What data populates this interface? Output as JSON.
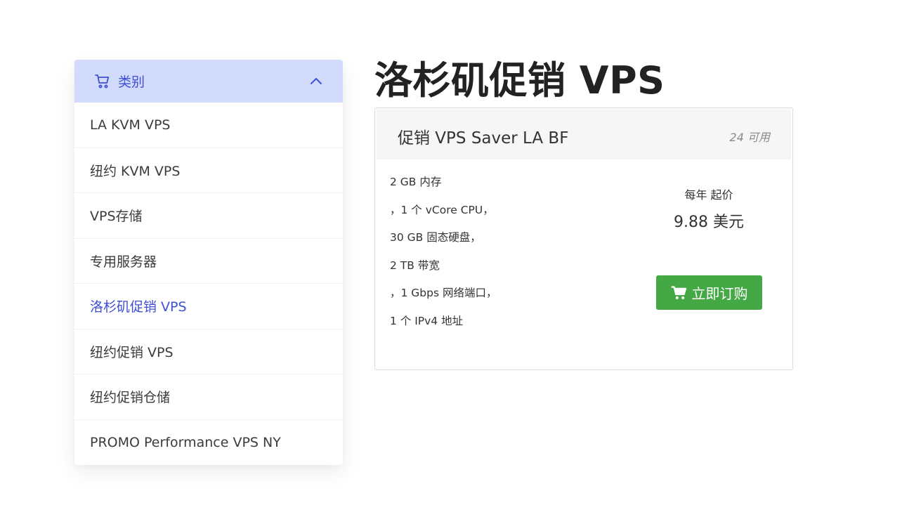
{
  "sidebar": {
    "header_title": "类别",
    "items": [
      {
        "label": "LA KVM VPS"
      },
      {
        "label": "纽约 KVM VPS"
      },
      {
        "label": "VPS存储"
      },
      {
        "label": "专用服务器"
      },
      {
        "label": "洛杉矶促销 VPS",
        "active": true
      },
      {
        "label": "纽约促销 VPS"
      },
      {
        "label": "纽约促销仓储"
      },
      {
        "label": "PROMO Performance VPS NY"
      }
    ],
    "header_bg": "#d3dbfd",
    "accent": "#3f4fd6"
  },
  "page": {
    "title": "洛杉矶促销 VPS"
  },
  "product": {
    "name": "促销 VPS Saver LA BF",
    "availability": "24 可用",
    "features": [
      "2 GB 内存",
      "，1 个 vCore CPU，",
      "30 GB 固态硬盘，",
      "2 TB 带宽",
      "，1 Gbps 网络端口，",
      "1 个 IPv4 地址"
    ],
    "price_label": "每年 起价",
    "price_value": "9.88 美元",
    "order_label": "立即订购",
    "order_color": "#44a844"
  },
  "icons": {
    "header": "cart-icon",
    "collapse": "chevron-up-icon",
    "order": "cart-icon"
  }
}
